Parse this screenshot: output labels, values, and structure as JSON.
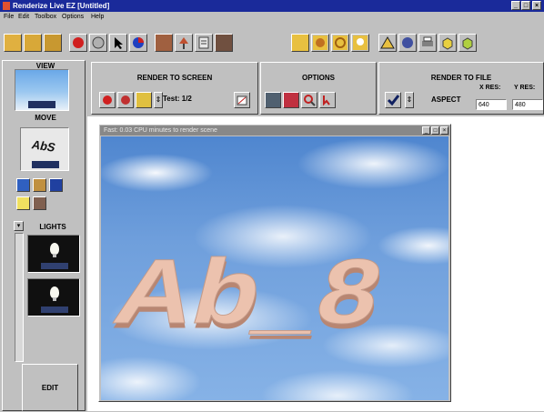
{
  "app": {
    "title": "Renderize Live EZ [Untitled]"
  },
  "menu": {
    "items": [
      "File",
      "Edit",
      "Toolbox",
      "Options",
      "Help"
    ]
  },
  "window_controls": {
    "minimize": "_",
    "maximize": "□",
    "close": "×"
  },
  "toolbar": {
    "icons": [
      "open-folder-icon",
      "save-folder-icon",
      "edit-folder-icon",
      "red-ball-icon",
      "object-icon",
      "pointer-icon",
      "color-ball-icon",
      "box-icon",
      "lamp-icon",
      "list-icon",
      "camera-icon",
      "yellow-square-icon",
      "sphere-icon",
      "ring-icon",
      "bulb-icon",
      "warning-icon",
      "ball-icon",
      "printer-icon",
      "cube-icon",
      "cubes-icon"
    ]
  },
  "left_panel": {
    "view_label": "VIEW",
    "move_label": "MOVE",
    "lights_label": "LIGHTS",
    "edit_label": "EDIT",
    "move_thumb_text": "AbS"
  },
  "render_to_screen": {
    "label": "RENDER TO SCREEN",
    "test_label": "Test: 1/2"
  },
  "options": {
    "label": "OPTIONS"
  },
  "render_to_file": {
    "label": "RENDER TO FILE",
    "aspect_label": "ASPECT",
    "xres_label": "X RES:",
    "yres_label": "Y RES:",
    "xres_value": "640",
    "yres_value": "480"
  },
  "render_window": {
    "title": "Fast:  0.03 CPU minutes to render scene",
    "scene_text": "Ab_8"
  },
  "colors": {
    "titlebar": "#1a2a9a",
    "sky": "#6f9fdc",
    "letters": "#ecc2ae"
  }
}
